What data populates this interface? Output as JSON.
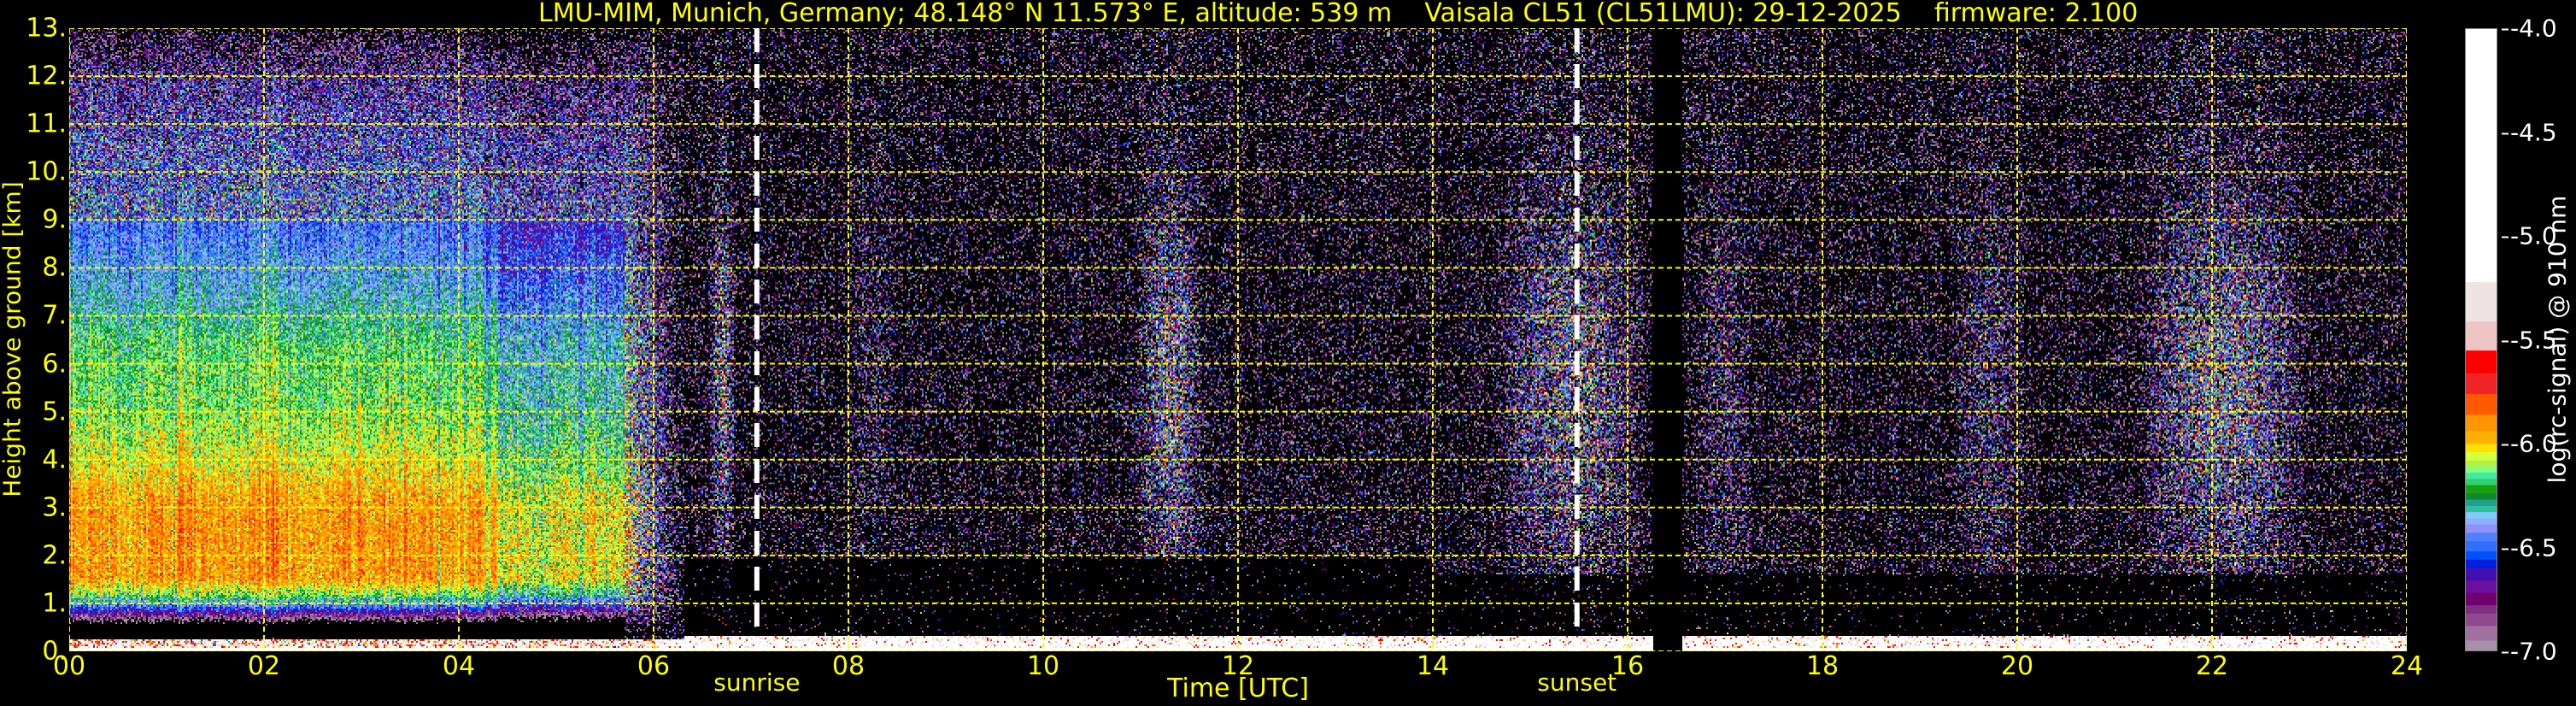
{
  "title": "LMU-MIM, Munich, Germany; 48.148° N 11.573° E, altitude: 539 m    Vaisala CL51 (CL51LMU): 29-12-2025    firmware: 2.100",
  "chart_data": {
    "type": "heatmap",
    "title": "LMU-MIM, Munich, Germany; 48.148° N 11.573° E, altitude: 539 m    Vaisala CL51 (CL51LMU): 29-12-2025    firmware: 2.100",
    "xlabel": "Time [UTC]",
    "ylabel": "Height above ground [km]",
    "xlim": [
      0,
      24
    ],
    "ylim": [
      0,
      13
    ],
    "xticks": [
      "00",
      "02",
      "04",
      "06",
      "08",
      "10",
      "12",
      "14",
      "16",
      "18",
      "20",
      "22",
      "24"
    ],
    "yticks": [
      "0.",
      "1.",
      "2.",
      "3.",
      "4.",
      "5.",
      "6.",
      "7.",
      "8.",
      "9.",
      "10.",
      "11.",
      "12.",
      "13."
    ],
    "grid": true,
    "grid_color": "#ffff00",
    "annotations": [
      {
        "label": "sunrise",
        "time": 7.06
      },
      {
        "label": "sunset",
        "time": 15.48
      }
    ],
    "data_gap": [
      16.25,
      16.55
    ],
    "colorbar": {
      "label": "log(rc-signal) @ 910 nm",
      "range": [
        -7.0,
        -4.0
      ],
      "ticks": [
        "-4.0",
        "-4.5",
        "-5.0",
        "-5.5",
        "-6.0",
        "-6.5",
        "-7.0"
      ],
      "segments": [
        [
          -7.0,
          -6.95,
          "#a890a8"
        ],
        [
          -6.95,
          -6.88,
          "#a070a0"
        ],
        [
          -6.88,
          -6.82,
          "#904890"
        ],
        [
          -6.82,
          -6.78,
          "#803080"
        ],
        [
          -6.78,
          -6.72,
          "#700070"
        ],
        [
          -6.72,
          -6.66,
          "#6a10a0"
        ],
        [
          -6.66,
          -6.6,
          "#4010b0"
        ],
        [
          -6.6,
          -6.56,
          "#0020e0"
        ],
        [
          -6.56,
          -6.52,
          "#0050ff"
        ],
        [
          -6.52,
          -6.47,
          "#3070ff"
        ],
        [
          -6.47,
          -6.43,
          "#5080ff"
        ],
        [
          -6.43,
          -6.39,
          "#9090ff"
        ],
        [
          -6.39,
          -6.36,
          "#8ab0ff"
        ],
        [
          -6.36,
          -6.33,
          "#80c8ff"
        ],
        [
          -6.33,
          -6.3,
          "#30c0a0"
        ],
        [
          -6.3,
          -6.27,
          "#20a090"
        ],
        [
          -6.27,
          -6.24,
          "#108830"
        ],
        [
          -6.24,
          -6.2,
          "#18a010"
        ],
        [
          -6.2,
          -6.17,
          "#30d070"
        ],
        [
          -6.17,
          -6.14,
          "#40e8a0"
        ],
        [
          -6.14,
          -6.11,
          "#80ff80"
        ],
        [
          -6.11,
          -6.08,
          "#b4f040"
        ],
        [
          -6.08,
          -6.04,
          "#d8ff3c"
        ],
        [
          -6.04,
          -6.0,
          "#ffe000"
        ],
        [
          -6.0,
          -5.94,
          "#ffb000"
        ],
        [
          -5.94,
          -5.86,
          "#ff9500"
        ],
        [
          -5.86,
          -5.76,
          "#ff5a00"
        ],
        [
          -5.76,
          -5.66,
          "#f02424"
        ],
        [
          -5.66,
          -5.55,
          "#ff0000"
        ],
        [
          -5.55,
          -5.41,
          "#efc4c4"
        ],
        [
          -5.41,
          -5.22,
          "#ede3e3"
        ],
        [
          -5.22,
          -4.0,
          "#ffffff"
        ]
      ]
    }
  }
}
